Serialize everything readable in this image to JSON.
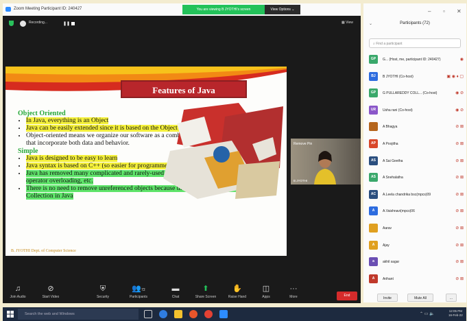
{
  "window": {
    "title": "Zoom Meeting Participant ID: 240427",
    "viewing_banner": "You are viewing B JYOTHI's screen",
    "view_options": "View Options ⌄"
  },
  "meeting": {
    "recording_label": "Recording...",
    "view_button": "View",
    "participant_video": {
      "name": "B JYOTHI",
      "remove_pin": "Remove Pin"
    }
  },
  "slide": {
    "title": "Features of Java",
    "sections": [
      {
        "heading": "Object Oriented",
        "bullets": [
          "In Java, everything is an Object",
          "Java can be easily extended since it is based on the Object model.",
          "Object-oriented means we organize our software as a combination of different types of objects that incorporate both data and behavior."
        ]
      },
      {
        "heading": "Simple",
        "bullets": [
          "Java is designed to be easy to learn",
          "Java syntax is based on C++ (so easier for programmers to learn it after C++).",
          "Java has removed many complicated and rarely-used features, for example, explicit pointers, operator overloading, etc.",
          "There is no need to remove unreferenced objects because there is an Automatic Garbage Collection in Java"
        ]
      }
    ],
    "footer": "B. JYOTHI  Dept. of Computer Science"
  },
  "toolbar": {
    "items": [
      {
        "label": "Join Audio",
        "icon": "headphones-icon",
        "glyph": "♫"
      },
      {
        "label": "Start Video",
        "icon": "video-off-icon",
        "glyph": "⊘"
      },
      {
        "label": "Security",
        "icon": "shield-icon",
        "glyph": "⛨"
      },
      {
        "label": "Participants",
        "icon": "participants-icon",
        "glyph": "👥"
      },
      {
        "label": "Chat",
        "icon": "chat-icon",
        "glyph": "▬"
      },
      {
        "label": "Share Screen",
        "icon": "share-screen-icon",
        "glyph": "⬆"
      },
      {
        "label": "Raise Hand",
        "icon": "raise-hand-icon",
        "glyph": "✋"
      },
      {
        "label": "Apps",
        "icon": "apps-icon",
        "glyph": "◫"
      },
      {
        "label": "More",
        "icon": "more-icon",
        "glyph": "···"
      }
    ],
    "participants_count": "72",
    "end_label": "End"
  },
  "participants_panel": {
    "title": "Participants (72)",
    "search_placeholder": "Find a participant",
    "rows": [
      {
        "initials": "GP",
        "color": "#3aa86b",
        "name": "G... (Host, me, participant ID: 240427)",
        "icons": "◉"
      },
      {
        "initials": "BJ",
        "color": "#2d6cdf",
        "name": "B JYOTHI (Co-host)",
        "icons": "▣ ◉ ♦ ▢"
      },
      {
        "initials": "GP",
        "color": "#3aa86b",
        "name": "G PULLAREDDY COLL... (Co-host)",
        "icons": "◉ ⊘"
      },
      {
        "initials": "UR",
        "color": "#8b57c9",
        "name": "Usha rani (Co-host)",
        "icons": "◉ ⊘"
      },
      {
        "initials": "",
        "color": "#b5651d",
        "name": "A Bhagya",
        "icons": "⊘ ⊠"
      },
      {
        "initials": "AP",
        "color": "#d9482b",
        "name": "A Poojitha",
        "icons": "⊘ ⊠"
      },
      {
        "initials": "AS",
        "color": "#2b4f7f",
        "name": "A Sai Geetha",
        "icons": "⊘ ⊠"
      },
      {
        "initials": "AS",
        "color": "#3aa86b",
        "name": "A Snehalatha",
        "icons": "⊘ ⊠"
      },
      {
        "initials": "AC",
        "color": "#2b4f7f",
        "name": "A.Leela chandrika bsc(mpcs)09",
        "icons": "⊘ ⊠"
      },
      {
        "initials": "A",
        "color": "#2d6cdf",
        "name": "A.Vaishnavi(mpcs)06",
        "icons": "⊘ ⊠"
      },
      {
        "initials": "",
        "color": "#e0a020",
        "name": "Aarav",
        "icons": "⊘ ⊠"
      },
      {
        "initials": "A",
        "color": "#e0a020",
        "name": "Ajay",
        "icons": "⊘ ⊠"
      },
      {
        "initials": "a",
        "color": "#6b4fb3",
        "name": "akhil sagar",
        "icons": "⊘ ⊠"
      },
      {
        "initials": "A",
        "color": "#c0392b",
        "name": "Arihant",
        "icons": "⊘ ⊠"
      }
    ],
    "invite_label": "Invite",
    "mute_all_label": "Mute All",
    "more_label": "..."
  },
  "taskbar": {
    "search_placeholder": "Search the web and Windows",
    "time": "12:05 PM",
    "date": "16-Feb-22"
  }
}
